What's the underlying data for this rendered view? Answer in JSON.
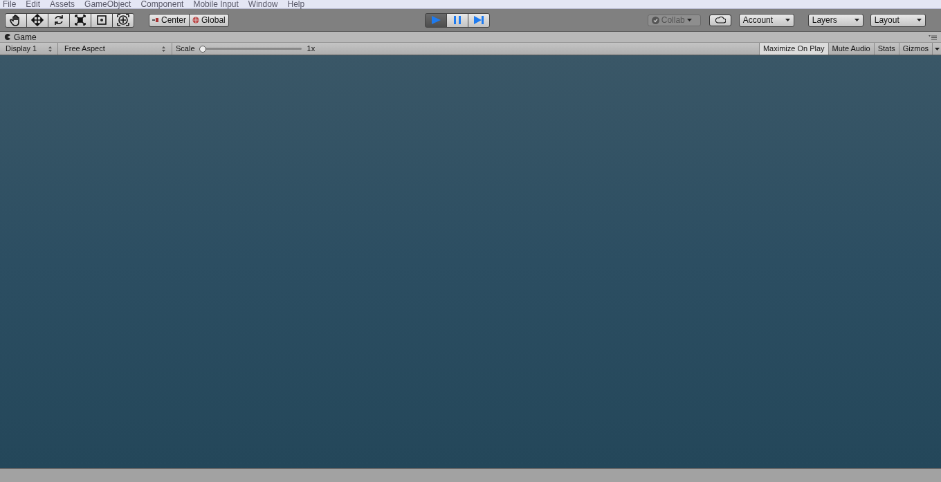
{
  "menu": [
    "File",
    "Edit",
    "Assets",
    "GameObject",
    "Component",
    "Mobile Input",
    "Window",
    "Help"
  ],
  "tools": [
    {
      "kind": "hand"
    },
    {
      "kind": "move"
    },
    {
      "kind": "rotate"
    },
    {
      "kind": "scale"
    },
    {
      "kind": "rect"
    },
    {
      "kind": "transform"
    }
  ],
  "pivot": [
    {
      "kind": "center",
      "label": "Center"
    },
    {
      "kind": "global",
      "label": "Global"
    }
  ],
  "playback": [
    {
      "kind": "play",
      "selected": true
    },
    {
      "kind": "pause",
      "selected": false
    },
    {
      "kind": "step",
      "selected": false
    }
  ],
  "collab": {
    "label": "Collab",
    "disabled": true
  },
  "dropdowns": [
    "Account",
    "Layers",
    "Layout"
  ],
  "game_tab": {
    "title": "Game"
  },
  "game_toolbar": {
    "display": "Display 1",
    "aspect": "Free Aspect",
    "scale_label": "Scale",
    "scale": {
      "level": 0.0
    },
    "scale_reading": "1x",
    "toggles": [
      {
        "label": "Maximize On Play",
        "selected": true
      },
      {
        "label": "Mute Audio",
        "selected": false
      },
      {
        "label": "Stats",
        "selected": false
      },
      {
        "label": "Gizmos",
        "selected": false
      }
    ]
  }
}
